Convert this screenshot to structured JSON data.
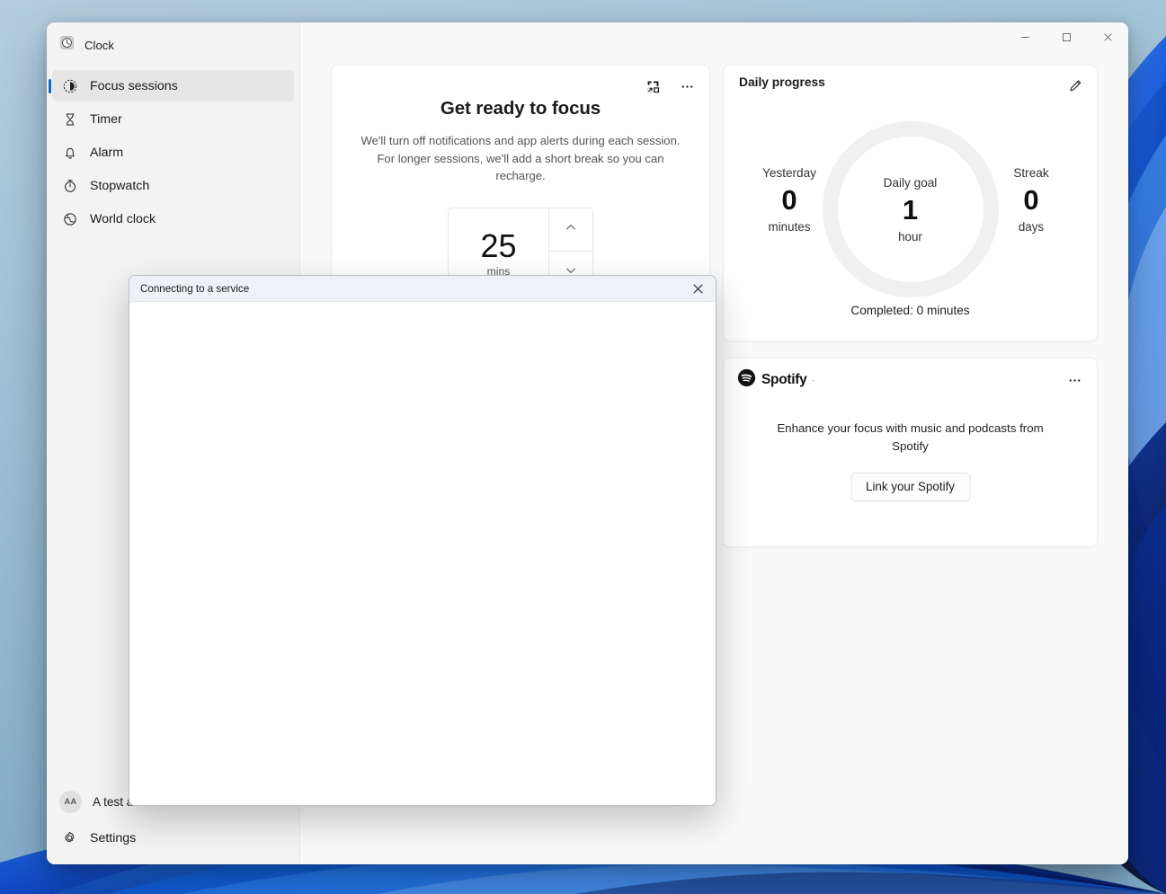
{
  "window": {
    "app_title": "Clock",
    "app_icon": "clock-icon",
    "controls": {
      "minimize": "minimize-icon",
      "maximize": "maximize-icon",
      "close": "close-icon"
    }
  },
  "sidebar": {
    "items": [
      {
        "label": "Focus sessions",
        "icon": "focus-sessions-icon",
        "selected": true
      },
      {
        "label": "Timer",
        "icon": "timer-hourglass-icon",
        "selected": false
      },
      {
        "label": "Alarm",
        "icon": "alarm-bell-icon",
        "selected": false
      },
      {
        "label": "Stopwatch",
        "icon": "stopwatch-icon",
        "selected": false
      },
      {
        "label": "World clock",
        "icon": "globe-icon",
        "selected": false
      }
    ],
    "account": {
      "initials": "AA",
      "label": "A test account"
    },
    "settings": {
      "label": "Settings",
      "icon": "gear-icon"
    }
  },
  "focus_card": {
    "heading": "Get ready to focus",
    "description": "We'll turn off notifications and app alerts during each session. For longer sessions, we'll add a short break so you can recharge.",
    "popout_icon": "compact-overlay-icon",
    "more_icon": "more-options-icon",
    "stepper": {
      "value": "25",
      "unit": "mins",
      "increase_icon": "chevron-up-icon",
      "decrease_icon": "chevron-down-icon"
    }
  },
  "progress_card": {
    "title": "Daily progress",
    "edit_icon": "pencil-edit-icon",
    "yesterday": {
      "label": "Yesterday",
      "value": "0",
      "unit": "minutes"
    },
    "daily_goal": {
      "label": "Daily goal",
      "value": "1",
      "unit": "hour"
    },
    "streak": {
      "label": "Streak",
      "value": "0",
      "unit": "days"
    },
    "completed": "Completed: 0 minutes",
    "ring_track_color": "#f0f0f0",
    "ring_progress_percent": 0
  },
  "spotify_card": {
    "brand": "Spotify",
    "registered_mark": "·",
    "logo_icon": "spotify-logo-icon",
    "more_icon": "more-options-icon",
    "description": "Enhance your focus with music and podcasts from Spotify",
    "link_button": "Link your Spotify"
  },
  "dialog": {
    "title": "Connecting to a service",
    "close_icon": "close-icon",
    "body_text": ""
  },
  "colors": {
    "accent": "#0f6cbd",
    "sidebar_bg": "#f3f3f3",
    "content_bg": "#f9f9f9",
    "card_bg": "#ffffff",
    "dialog_titlebar": "#eef2f6"
  }
}
